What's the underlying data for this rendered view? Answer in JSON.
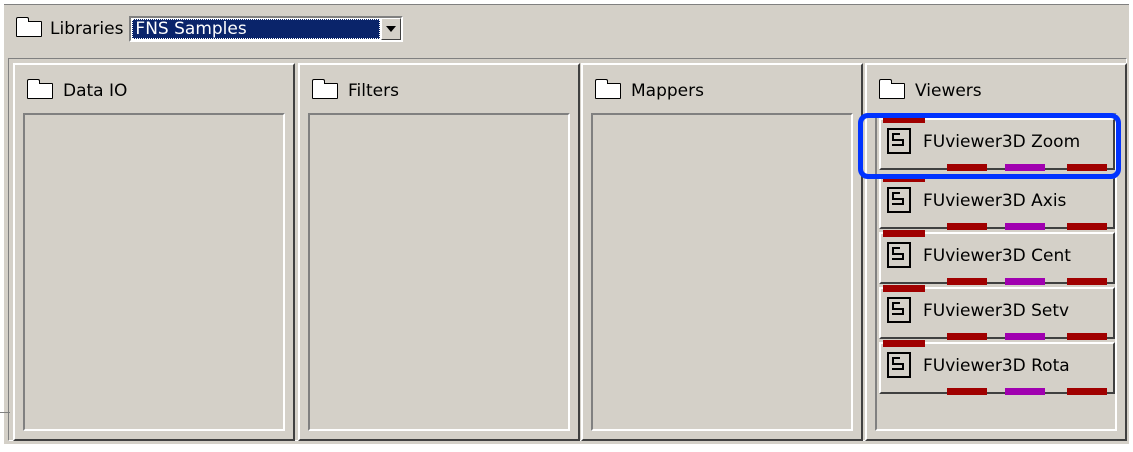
{
  "library_bar": {
    "label": "Libraries",
    "selected": "FNS Samples"
  },
  "panels": [
    {
      "title": "Data IO",
      "modules": []
    },
    {
      "title": "Filters",
      "modules": []
    },
    {
      "title": "Mappers",
      "modules": []
    },
    {
      "title": "Viewers",
      "modules": [
        {
          "label": "FUviewer3D Zoom",
          "selected": true
        },
        {
          "label": "FUviewer3D Axis"
        },
        {
          "label": "FUviewer3D Cent"
        },
        {
          "label": "FUviewer3D Setv"
        },
        {
          "label": "FUviewer3D Rota"
        }
      ]
    }
  ],
  "colors": {
    "background": "#d4d0c8",
    "selection": "#0a246a",
    "highlight_ring": "#0033ff",
    "port_red": "#a00000",
    "port_purple": "#a000b0"
  },
  "icons": {
    "folder": "folder-icon",
    "module": "module-icon",
    "dropdown": "chevron-down-icon"
  }
}
